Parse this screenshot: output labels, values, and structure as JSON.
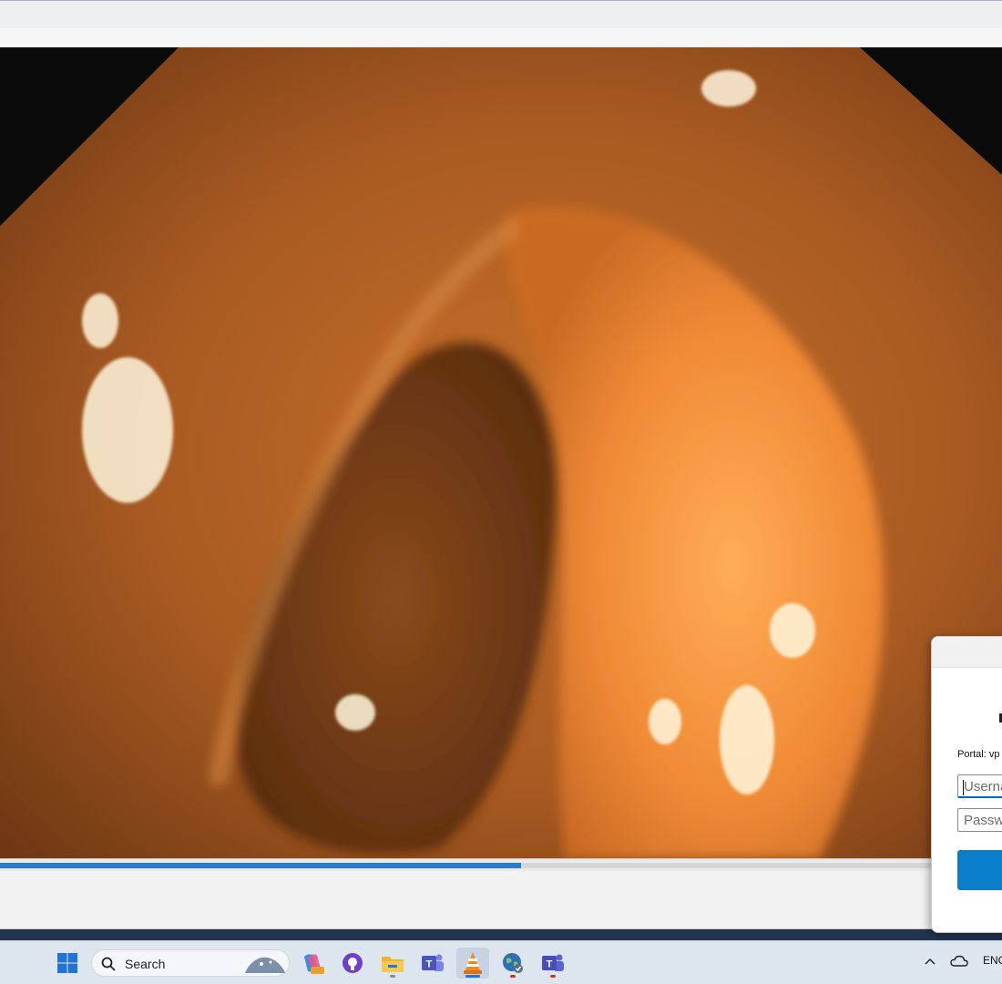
{
  "app": {
    "progress_fraction": 0.52
  },
  "dialog": {
    "portal_label": "Portal: vp",
    "username_placeholder": "Username",
    "password_placeholder": "Password"
  },
  "taskbar": {
    "search_label": "Search",
    "language": "ENG",
    "pinned_icons": [
      "copilot-icon",
      "github-desktop-icon",
      "file-explorer-icon",
      "teams-icon",
      "vlc-icon",
      "vpn-globe-icon",
      "teams-work-icon"
    ]
  },
  "colors": {
    "accent": "#2b7bd1",
    "connect_button": "#0a7ecb"
  }
}
